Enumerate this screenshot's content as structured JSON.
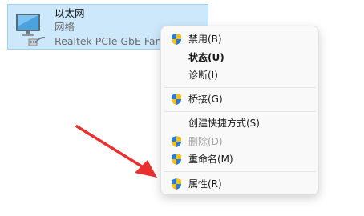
{
  "adapter": {
    "name": "以太网",
    "type": "网络",
    "description": "Realtek PCIe GbE Family Controller",
    "icon": "network-adapter-icon"
  },
  "context_menu": {
    "items": [
      {
        "label": "禁用(B)",
        "shield": true,
        "bold": false,
        "disabled": false
      },
      {
        "label": "状态(U)",
        "shield": false,
        "bold": true,
        "disabled": false
      },
      {
        "label": "诊断(I)",
        "shield": false,
        "bold": false,
        "disabled": false
      },
      {
        "label": "桥接(G)",
        "shield": true,
        "bold": false,
        "disabled": false
      },
      {
        "label": "创建快捷方式(S)",
        "shield": false,
        "bold": false,
        "disabled": false
      },
      {
        "label": "删除(D)",
        "shield": true,
        "bold": false,
        "disabled": true
      },
      {
        "label": "重命名(M)",
        "shield": true,
        "bold": false,
        "disabled": false
      },
      {
        "label": "属性(R)",
        "shield": true,
        "bold": false,
        "disabled": false
      }
    ]
  },
  "colors": {
    "selection_bg": "#cde8fb",
    "selection_border": "#99d1f7",
    "menu_bg": "#f9f9f9",
    "arrow": "#e8312f"
  }
}
